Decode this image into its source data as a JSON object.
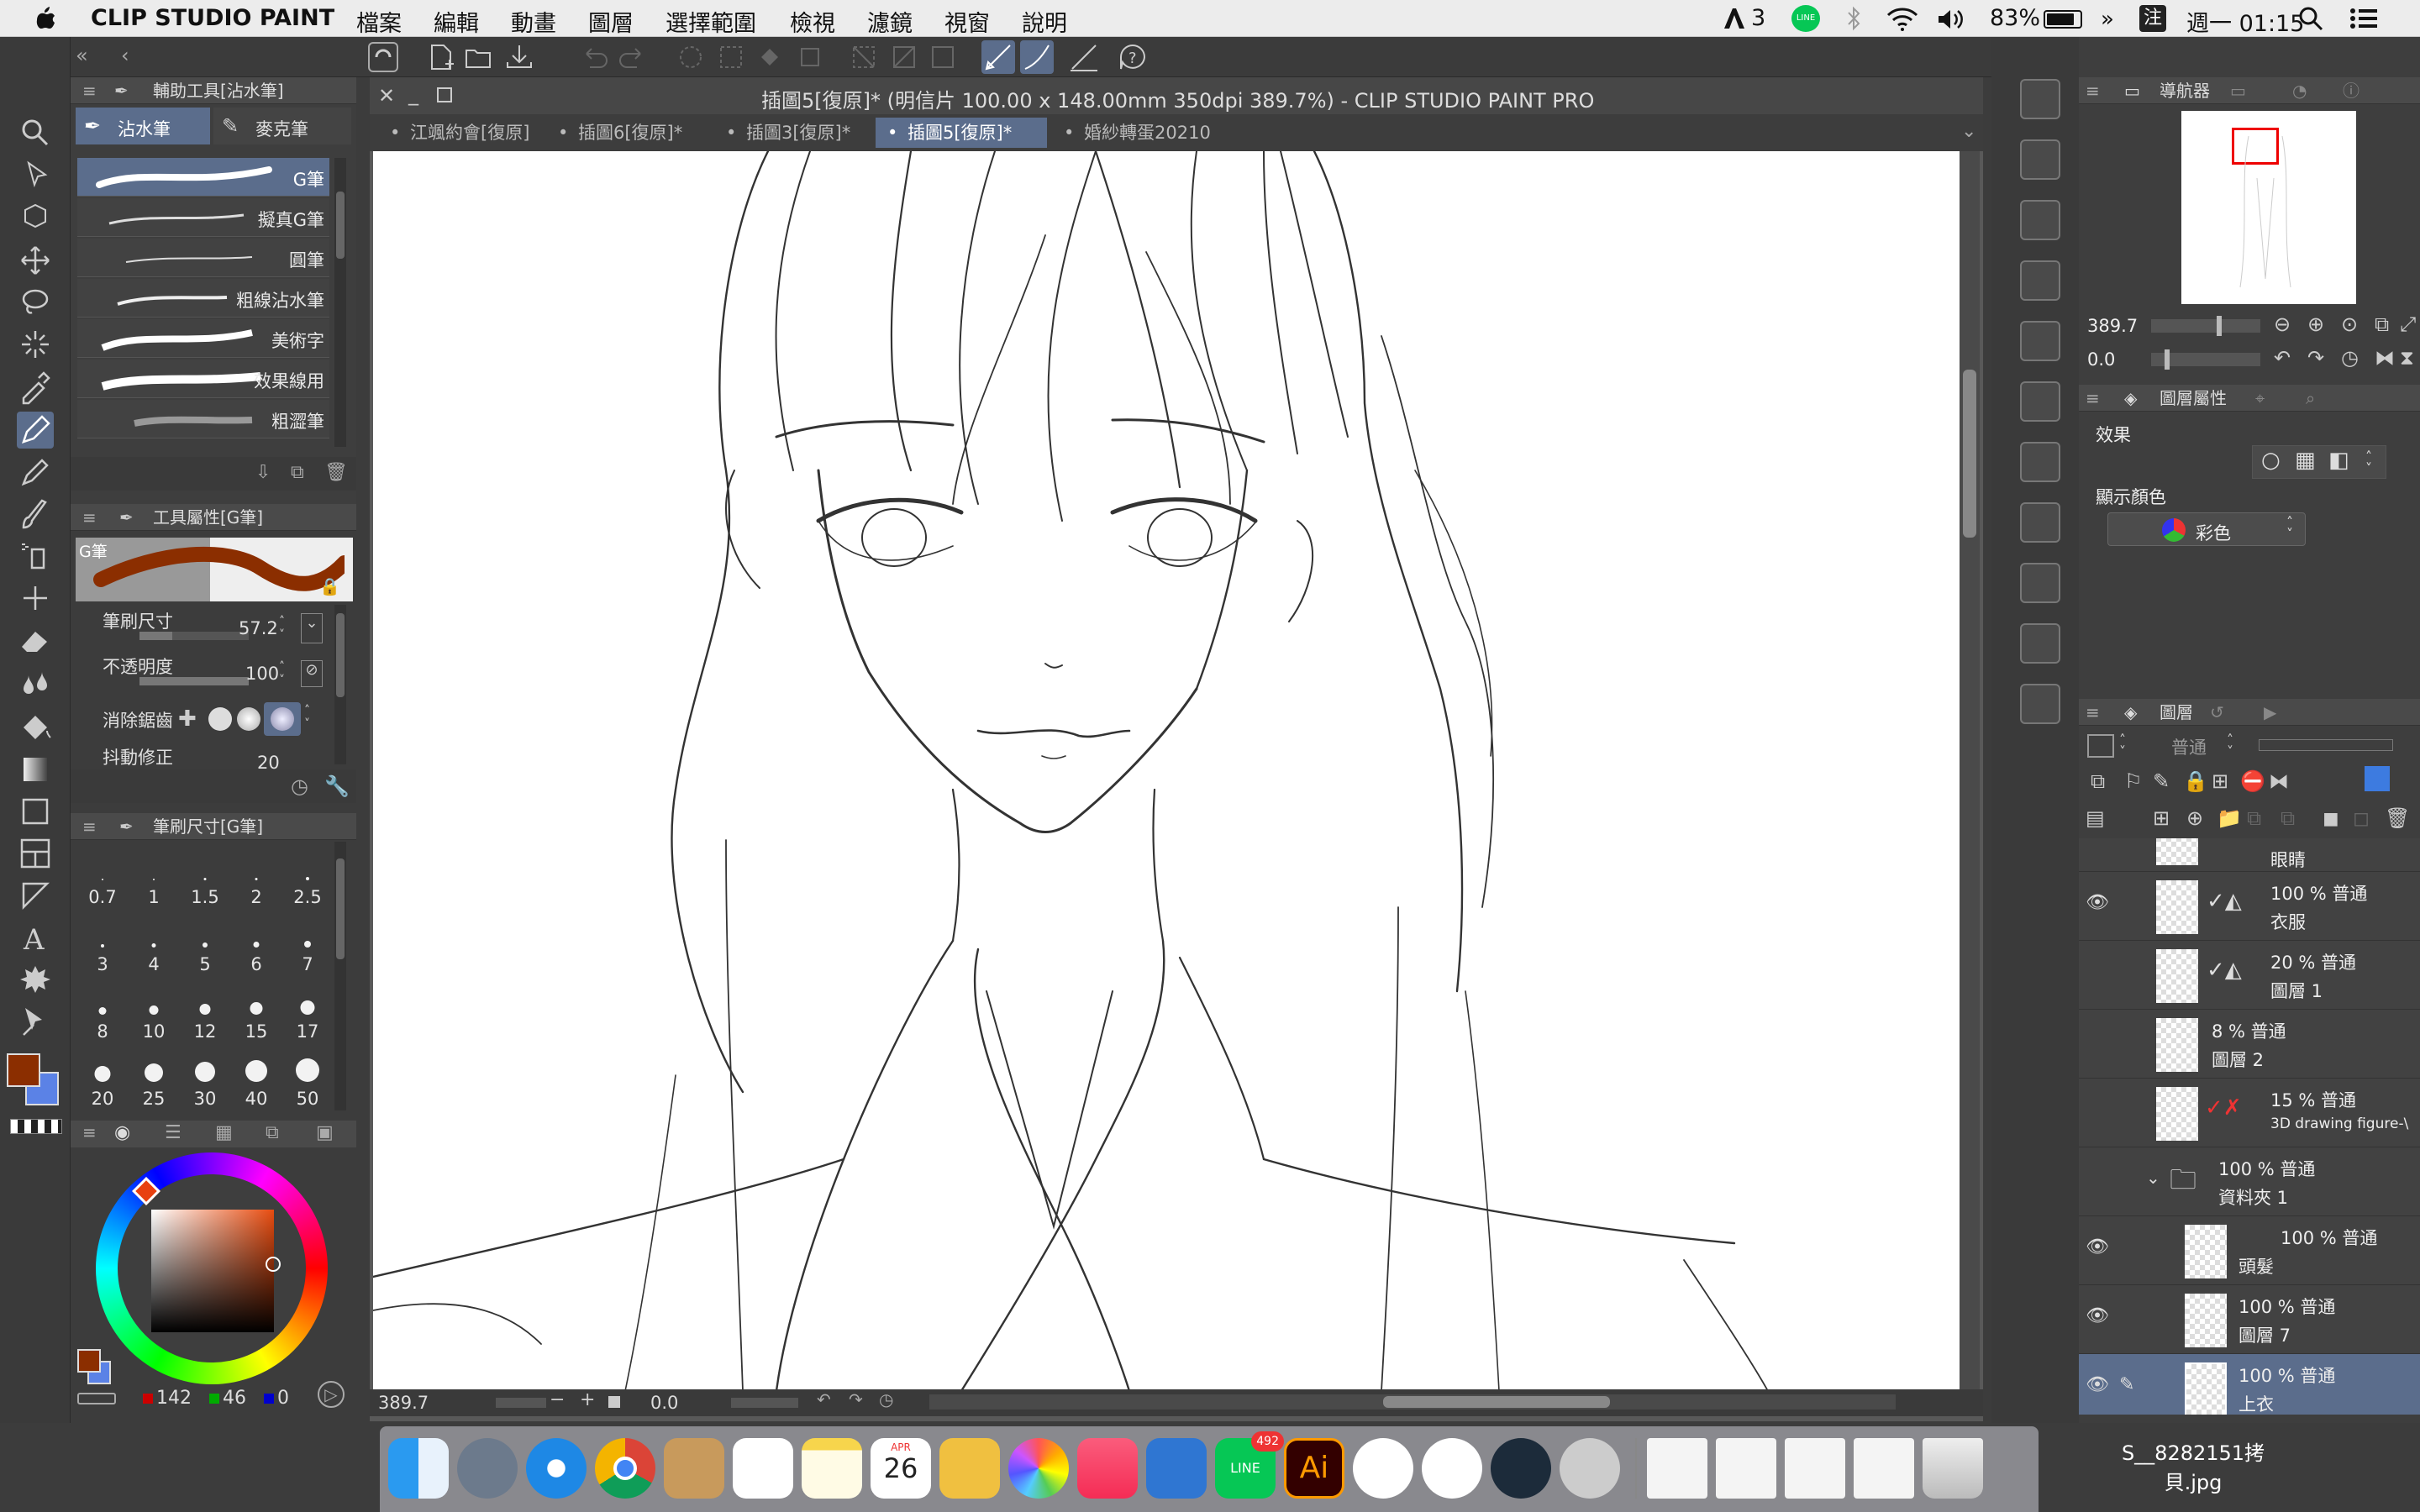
{
  "menubar": {
    "app_name": "CLIP STUDIO PAINT",
    "items": [
      "檔案",
      "編輯",
      "動畫",
      "圖層",
      "選擇範圍",
      "檢視",
      "濾鏡",
      "視窗",
      "說明"
    ],
    "status": {
      "adobe_count": "3",
      "battery": "83%",
      "input": "注",
      "clock": "週一 01:15"
    }
  },
  "document": {
    "title": "插圖5[復原]* (明信片 100.00 x 148.00mm 350dpi 389.7%)  - CLIP STUDIO PAINT PRO",
    "tabs": [
      "江颯約會[復原]",
      "插圖6[復原]*",
      "插圖3[復原]*",
      "插圖5[復原]*",
      "婚紗轉蛋20210"
    ],
    "active_tab": 3
  },
  "sub_tool_panel": {
    "title": "輔助工具[沾水筆]",
    "tabs": [
      "沾水筆",
      "麥克筆"
    ],
    "brushes": [
      "G筆",
      "擬真G筆",
      "圓筆",
      "粗線沾水筆",
      "美術字",
      "效果線用",
      "粗澀筆"
    ]
  },
  "tool_property": {
    "title": "工具屬性[G筆]",
    "preview_label": "G筆",
    "brush_size_label": "筆刷尺寸",
    "brush_size": "57.2",
    "opacity_label": "不透明度",
    "opacity": "100",
    "antialias_label": "消除鋸齒",
    "stabilization_label": "抖動修正",
    "stabilization": "20"
  },
  "brush_size_panel": {
    "title": "筆刷尺寸[G筆]",
    "sizes": [
      "0.7",
      "1",
      "1.5",
      "2",
      "2.5",
      "3",
      "4",
      "5",
      "6",
      "7",
      "8",
      "10",
      "12",
      "15",
      "17",
      "20",
      "25",
      "30",
      "40",
      "50"
    ]
  },
  "color": {
    "main": "#8b2e00",
    "sub": "#5b82e6",
    "r": "142",
    "g": "46",
    "b": "0"
  },
  "canvas_status": {
    "zoom": "389.7",
    "rotate": "0.0"
  },
  "navigator": {
    "title": "導航器",
    "zoom": "389.7",
    "rotate": "0.0"
  },
  "layer_property": {
    "title": "圖層屬性",
    "effect_label": "效果",
    "display_color_label": "顯示顏色",
    "display_color": "彩色"
  },
  "layer_panel": {
    "title": "圖層",
    "blend": "普通",
    "layers": [
      {
        "top": "",
        "name": "眼睛"
      },
      {
        "top": "100 % 普通",
        "name": "衣服"
      },
      {
        "top": "20 % 普通",
        "name": "圖層 1"
      },
      {
        "top": "8 % 普通",
        "name": "圖層 2"
      },
      {
        "top": "15 % 普通",
        "name": "3D drawing figure-\\"
      },
      {
        "top": "100 % 普通",
        "name": "資料夾 1"
      },
      {
        "top": "100 % 普通",
        "name": "頭髮"
      },
      {
        "top": "100 % 普通",
        "name": "圖層 7"
      },
      {
        "top": "100 % 普通",
        "name": "上衣"
      }
    ]
  },
  "dock": {
    "calendar_month": "APR",
    "calendar_day": "26",
    "line_badge": "492",
    "desktop_file": "S__8282151拷貝.jpg"
  }
}
